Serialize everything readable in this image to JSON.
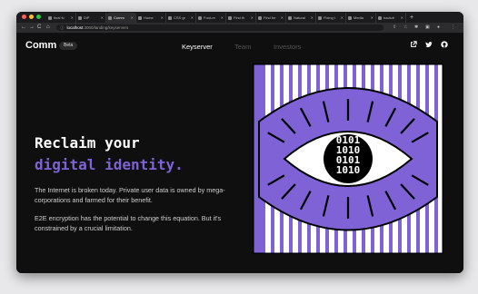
{
  "browser": {
    "lights": [
      "#ff5f57",
      "#febc2e",
      "#28c840"
    ],
    "tabs": [
      {
        "label": "final fo",
        "active": false
      },
      {
        "label": "DiP",
        "active": false
      },
      {
        "label": "Comm",
        "active": true
      },
      {
        "label": "Home",
        "active": false
      },
      {
        "label": "CSS gr",
        "active": false
      },
      {
        "label": "Font-re",
        "active": false
      },
      {
        "label": "Find th",
        "active": false
      },
      {
        "label": "Find be",
        "active": false
      },
      {
        "label": "Natural",
        "active": false
      },
      {
        "label": "Fixing t",
        "active": false
      },
      {
        "label": "Media",
        "active": false
      },
      {
        "label": "backdr",
        "active": false
      }
    ],
    "new_tab": "+",
    "back_icon": "←",
    "forward_icon": "→",
    "reload_icon": "C",
    "home_icon": "⌂",
    "url_host": "localhost",
    "url_path": ":3000/landing/keyservers"
  },
  "site": {
    "logo": "Comm",
    "badge": "Beta",
    "nav": [
      {
        "label": "Keyserver",
        "active": true
      },
      {
        "label": "Team",
        "active": false
      },
      {
        "label": "Investors",
        "active": false
      }
    ],
    "social_icons": [
      "external-link-icon",
      "twitter-icon",
      "github-icon"
    ],
    "hero": {
      "line1": "Reclaim your",
      "line2": "digital identity.",
      "para1": "The Internet is broken today. Private user data is owned by mega-corporations and farmed for their benefit.",
      "para2": "E2E encryption has the potential to change this equation. But it's constrained by a crucial limitation."
    },
    "art": {
      "binary": [
        "0101",
        "1010",
        "0101",
        "1010"
      ],
      "purple": "#7e62d6"
    }
  }
}
